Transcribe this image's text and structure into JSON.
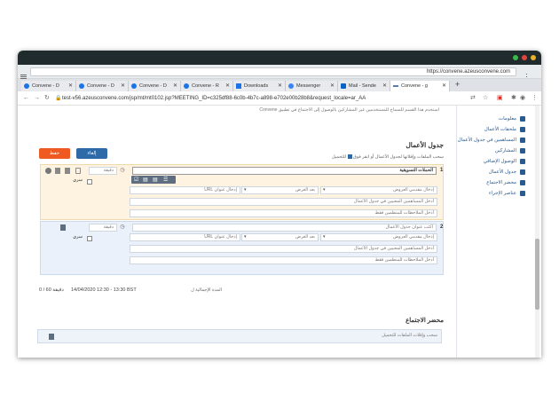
{
  "browser": {
    "address_bar_text": "https://convene.azeusconvene.com",
    "url": "test-v56.azeusconvene.com/jsp/mt/mt0102.jsp?MEETING_ID=c325df88-6c0b-4b7c-a898-e702e00b28b8&request_locale=ar_AA",
    "tabs": [
      {
        "label": "Convene - D"
      },
      {
        "label": "Convene - D"
      },
      {
        "label": "Convene - D"
      },
      {
        "label": "Convene - R"
      },
      {
        "label": "Downloads"
      },
      {
        "label": "Messenger"
      },
      {
        "label": "Mail - Sende"
      },
      {
        "label": "Convene - g"
      }
    ],
    "new_tab": "+"
  },
  "page": {
    "info_line": "استخدم هذا القسم للسماح للمستخدمين غير المشاركين بالوصول إلى الاجتماع في تطبيق Convene",
    "sidebar": [
      {
        "label": "معلومات"
      },
      {
        "label": "ملحقات الأعمال"
      },
      {
        "label": "المساهمين في جدول الأعمال"
      },
      {
        "label": "المشاركين"
      },
      {
        "label": "الوصول الإضافي"
      },
      {
        "label": "جدول الأعمال"
      },
      {
        "label": "محضر الاجتماع"
      },
      {
        "label": "عناصر الإجراء"
      }
    ],
    "buttons": {
      "cancel": "إلغاء",
      "save": "حفظ"
    },
    "agenda_title": "جدول الأعمال",
    "agenda_hint": "سحب الملفات وإفلاتها لجدول الأعمال أو انقر فوق",
    "agenda_hint_link": "للتحميل",
    "items": [
      {
        "number": "1",
        "title": "الحملات التسويقية",
        "duration_placeholder": "دقيقة",
        "presenter_placeholder": "إدخال مقدمي العروض",
        "purpose_placeholder": "بعد الغرض",
        "url_placeholder": "إدخال عنوان URL",
        "contributors_placeholder": "أدخل المساهمين المعنيين في جدول الأعمال",
        "notes_placeholder": "أدخل الملاحظات للمنظمين فقط",
        "secret_label": "سري"
      },
      {
        "number": "2",
        "title": "اكتب عنوان جدول الأعمال",
        "duration_placeholder": "دقيقة",
        "presenter_placeholder": "إدخال مقدمي العروض",
        "purpose_placeholder": "بعد الغرض",
        "url_placeholder": "إدخال عنوان URL",
        "contributors_placeholder": "أدخل المساهمين المعنيين في جدول الأعمال",
        "notes_placeholder": "أدخل الملاحظات للمنظمين فقط",
        "secret_label": "سري"
      }
    ],
    "total_duration_label": "المدة الإجمالية ل",
    "total_duration_value": "14/04/2020 12:30 - 13:30 BST",
    "duration_count": "0 / 60 دقيقة",
    "minutes_title": "محضر الاجتماع",
    "minutes_hint": "سحب وإفلات الملفات للتحميل"
  },
  "colors": {
    "cancel_button": "#2f6aa8",
    "save_button": "#ef5a22",
    "item1_bg": "#fdf3e0",
    "item2_bg": "#eaf1fa"
  }
}
